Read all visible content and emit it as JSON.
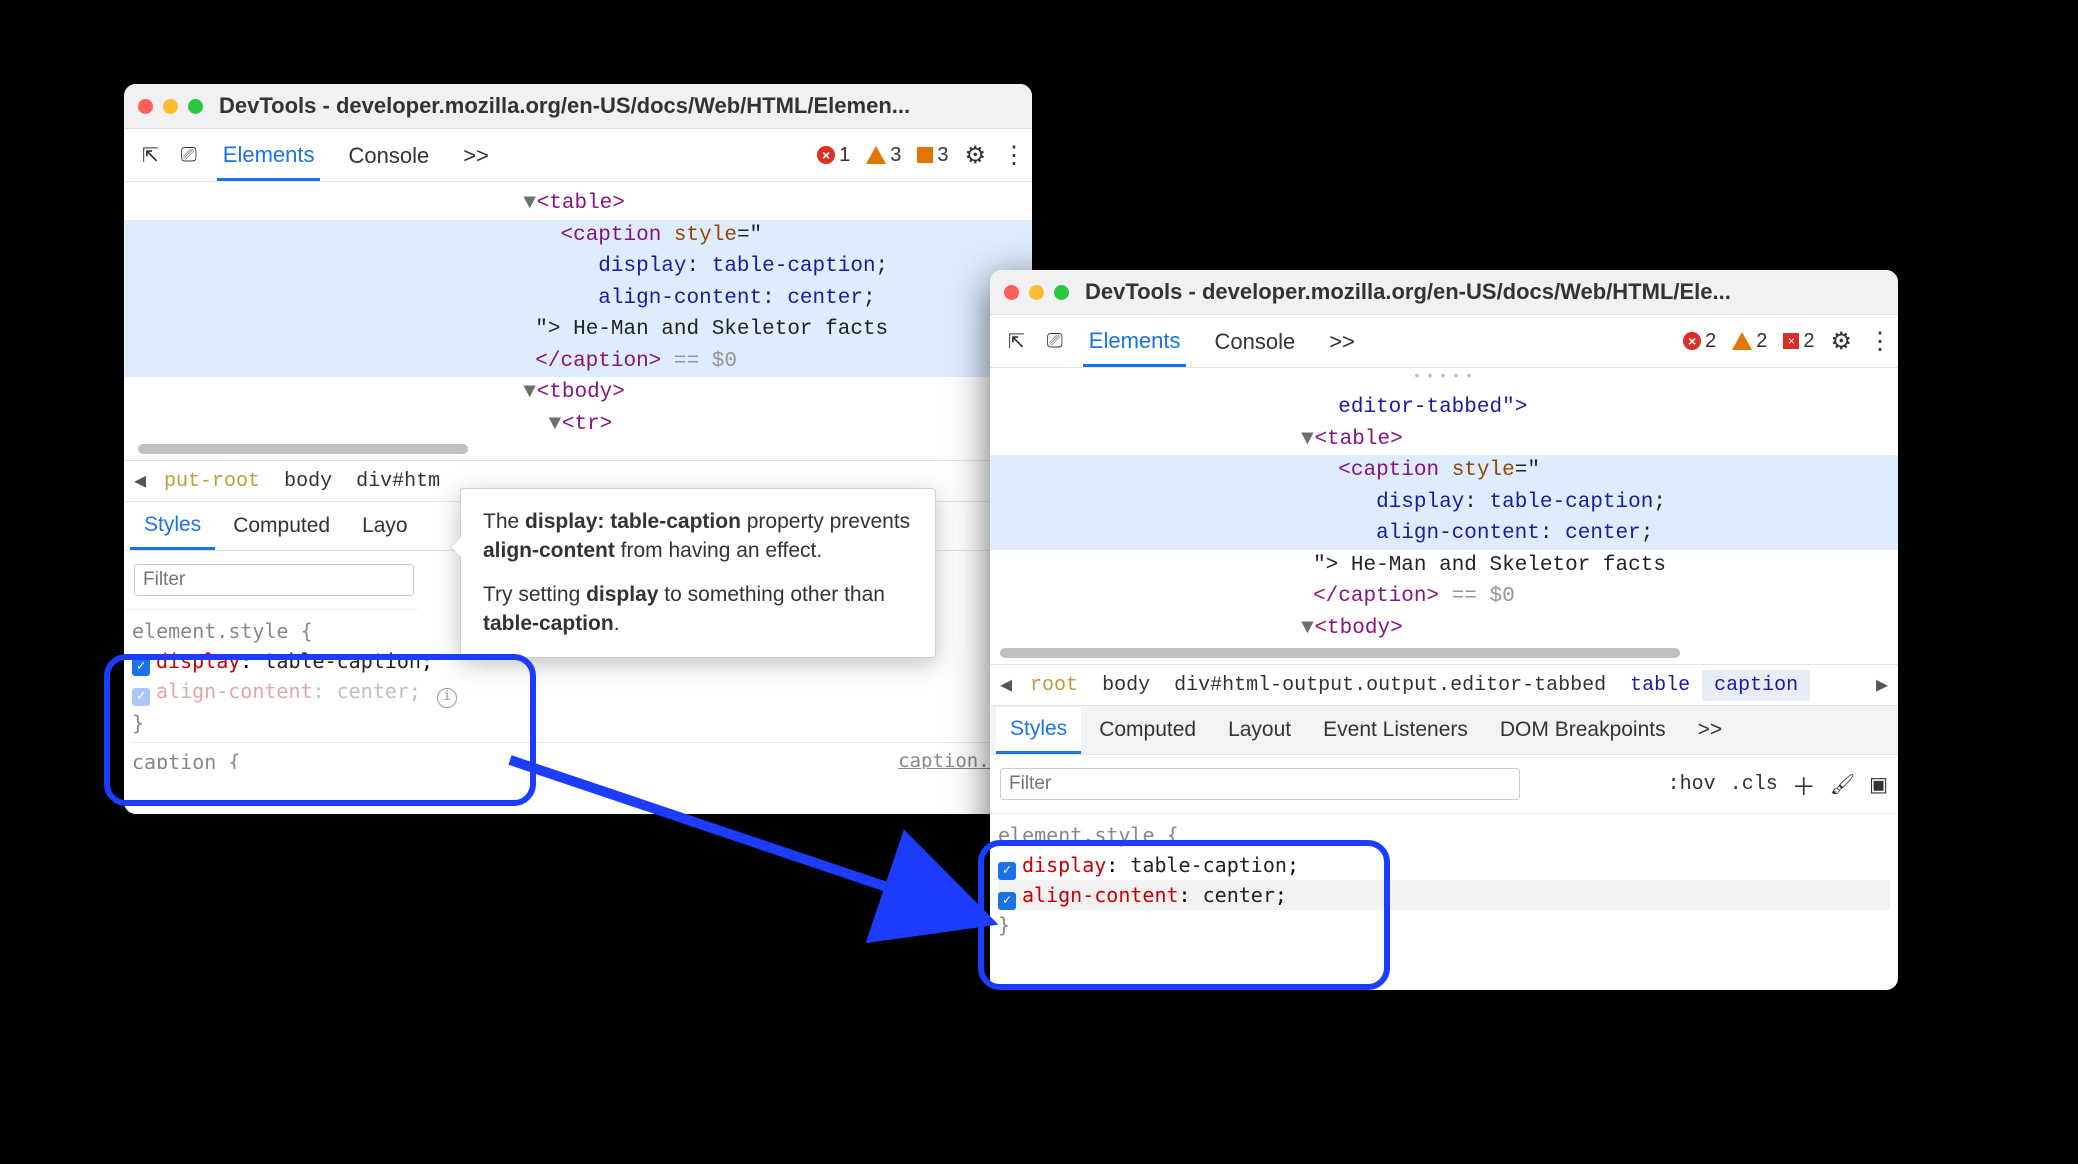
{
  "window_left": {
    "title": "DevTools - developer.mozilla.org/en-US/docs/Web/HTML/Elemen...",
    "tabs": {
      "elements": "Elements",
      "console": "Console",
      "more": ">>"
    },
    "counters": {
      "errors": "1",
      "warnings": "3",
      "issues": "3"
    },
    "dom": {
      "table_open": "<table>",
      "caption_open": "<caption",
      "style_attr": "style",
      "eq_quote": "=\"",
      "decl1_prop": "display",
      "decl1_val": "table-caption",
      "decl2_prop": "align-content",
      "decl2_val": "center",
      "close_quote": "\">",
      "caption_text": " He-Man and Skeletor facts",
      "caption_close": "</caption>",
      "eq_dollar": "== $0",
      "tbody_open": "<tbody>",
      "tr_open": "<tr>"
    },
    "breadcrumbs": {
      "partial": "put-root",
      "body": "body",
      "div": "div#htm"
    },
    "subtabs": {
      "styles": "Styles",
      "computed": "Computed",
      "layout": "Layo"
    },
    "filter_placeholder": "Filter",
    "styles": {
      "selector": "element.style ",
      "open_brace": "{",
      "close_brace": "}",
      "rule1_prop": "display",
      "rule1_val": "table-caption",
      "rule2_prop": "align-content",
      "rule2_val": "center"
    },
    "peek_selector": "caption ",
    "peek_origin": "caption.htm"
  },
  "window_right": {
    "title": "DevTools - developer.mozilla.org/en-US/docs/Web/HTML/Ele...",
    "tabs": {
      "elements": "Elements",
      "console": "Console",
      "more": ">>"
    },
    "counters": {
      "errors": "2",
      "warnings": "2",
      "issues": "2"
    },
    "dom": {
      "editor_tabbed": "editor-tabbed\">",
      "table_open": "<table>",
      "caption_open": "<caption",
      "style_attr": "style",
      "eq_quote": "=\"",
      "decl1_prop": "display",
      "decl1_val": "table-caption",
      "decl2_prop": "align-content",
      "decl2_val": "center",
      "close_quote": "\">",
      "caption_text": " He-Man and Skeletor facts",
      "caption_close": "</caption>",
      "eq_dollar": "== $0",
      "tbody_open": "<tbody>"
    },
    "breadcrumbs": {
      "root": "root",
      "body": "body",
      "div": "div#html-output.output.editor-tabbed",
      "table": "table",
      "caption": "caption"
    },
    "subtabs": {
      "styles": "Styles",
      "computed": "Computed",
      "layout": "Layout",
      "event": "Event Listeners",
      "dom": "DOM Breakpoints",
      "more": ">>"
    },
    "filter_placeholder": "Filter",
    "tools": {
      "hov": ":hov",
      "cls": ".cls"
    },
    "styles": {
      "selector": "element.style ",
      "open_brace": "{",
      "close_brace": "}",
      "rule1_prop": "display",
      "rule1_val": "table-caption",
      "rule2_prop": "align-content",
      "rule2_val": "center"
    }
  },
  "tooltip": {
    "line1_pre": "The ",
    "line1_b1": "display: table-caption",
    "line1_mid": " property prevents ",
    "line1_b2": "align-content",
    "line1_post": " from having an effect.",
    "line2_pre": "Try setting ",
    "line2_b1": "display",
    "line2_mid": " to something other than ",
    "line2_b2": "table-caption",
    "line2_post": "."
  }
}
